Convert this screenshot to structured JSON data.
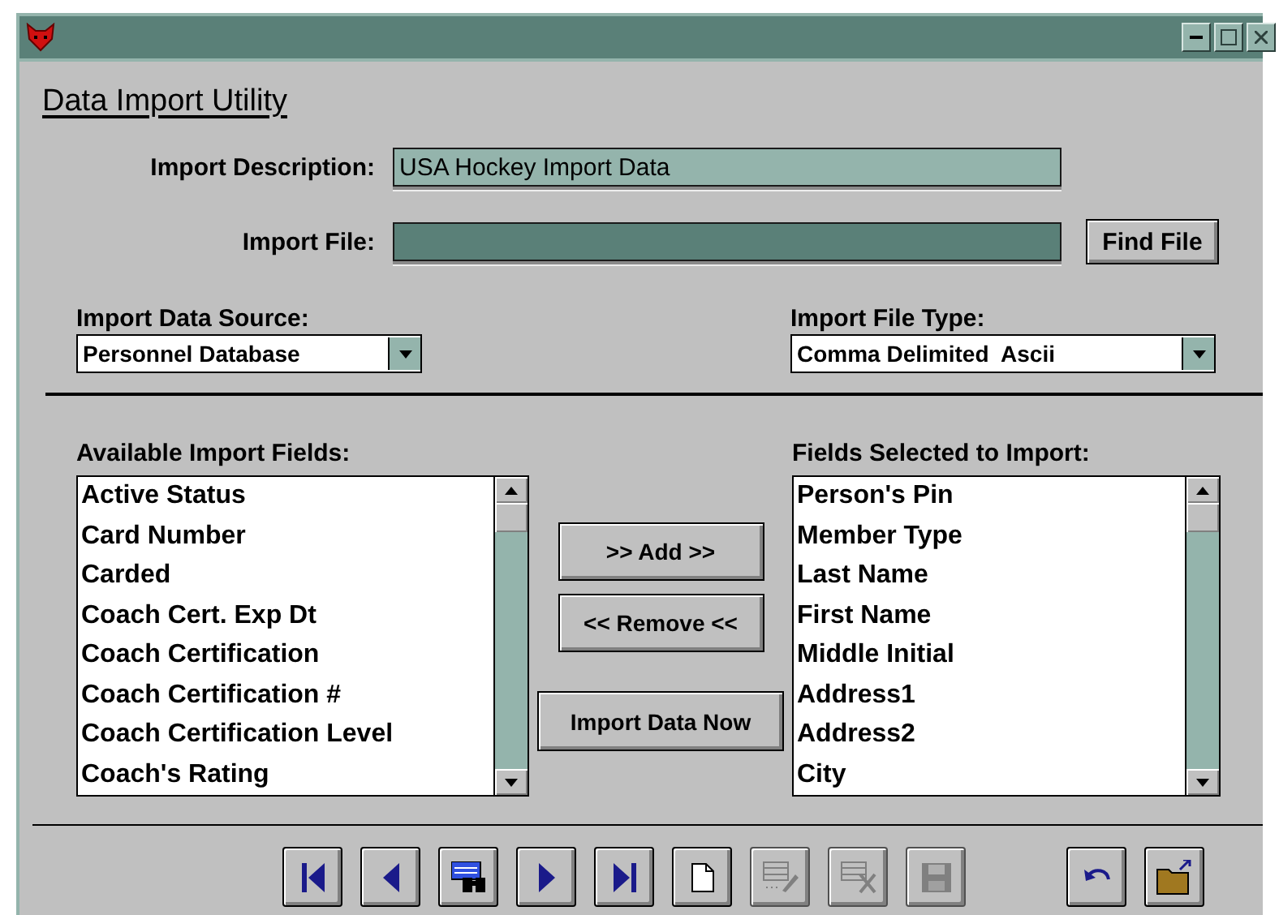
{
  "heading": "Data Import Utility",
  "import_description": {
    "label": "Import Description:",
    "value": "USA Hockey Import Data"
  },
  "import_file": {
    "label": "Import File:",
    "button": "Find File"
  },
  "data_source": {
    "label": "Import Data Source:",
    "value": "Personnel Database"
  },
  "file_type": {
    "label": "Import File Type:",
    "value": "Comma Delimited  Ascii"
  },
  "available_fields": {
    "label": "Available Import Fields:",
    "items": [
      "Active Status",
      "Card Number",
      "Carded",
      "Coach Cert. Exp Dt",
      "Coach Certification",
      "Coach Certification #",
      "Coach Certification Level",
      "Coach's Rating"
    ]
  },
  "selected_fields": {
    "label": "Fields Selected to Import:",
    "items": [
      "Person's Pin",
      "Member Type",
      "Last Name",
      "First Name",
      "Middle Initial",
      "Address1",
      "Address2",
      "City"
    ]
  },
  "actions": [
    ">> Add >>",
    "<< Remove <<",
    "Import Data Now"
  ],
  "toolbar": [
    {
      "kind": "first",
      "disabled": false
    },
    {
      "kind": "prev",
      "disabled": false
    },
    {
      "kind": "find",
      "disabled": false
    },
    {
      "kind": "next",
      "disabled": false
    },
    {
      "kind": "last",
      "disabled": false
    },
    {
      "kind": "new",
      "disabled": false
    },
    {
      "kind": "edit",
      "disabled": true
    },
    {
      "kind": "delete",
      "disabled": true
    },
    {
      "kind": "save",
      "disabled": true
    },
    {
      "kind": "undo",
      "disabled": false
    },
    {
      "kind": "open",
      "disabled": false
    }
  ]
}
